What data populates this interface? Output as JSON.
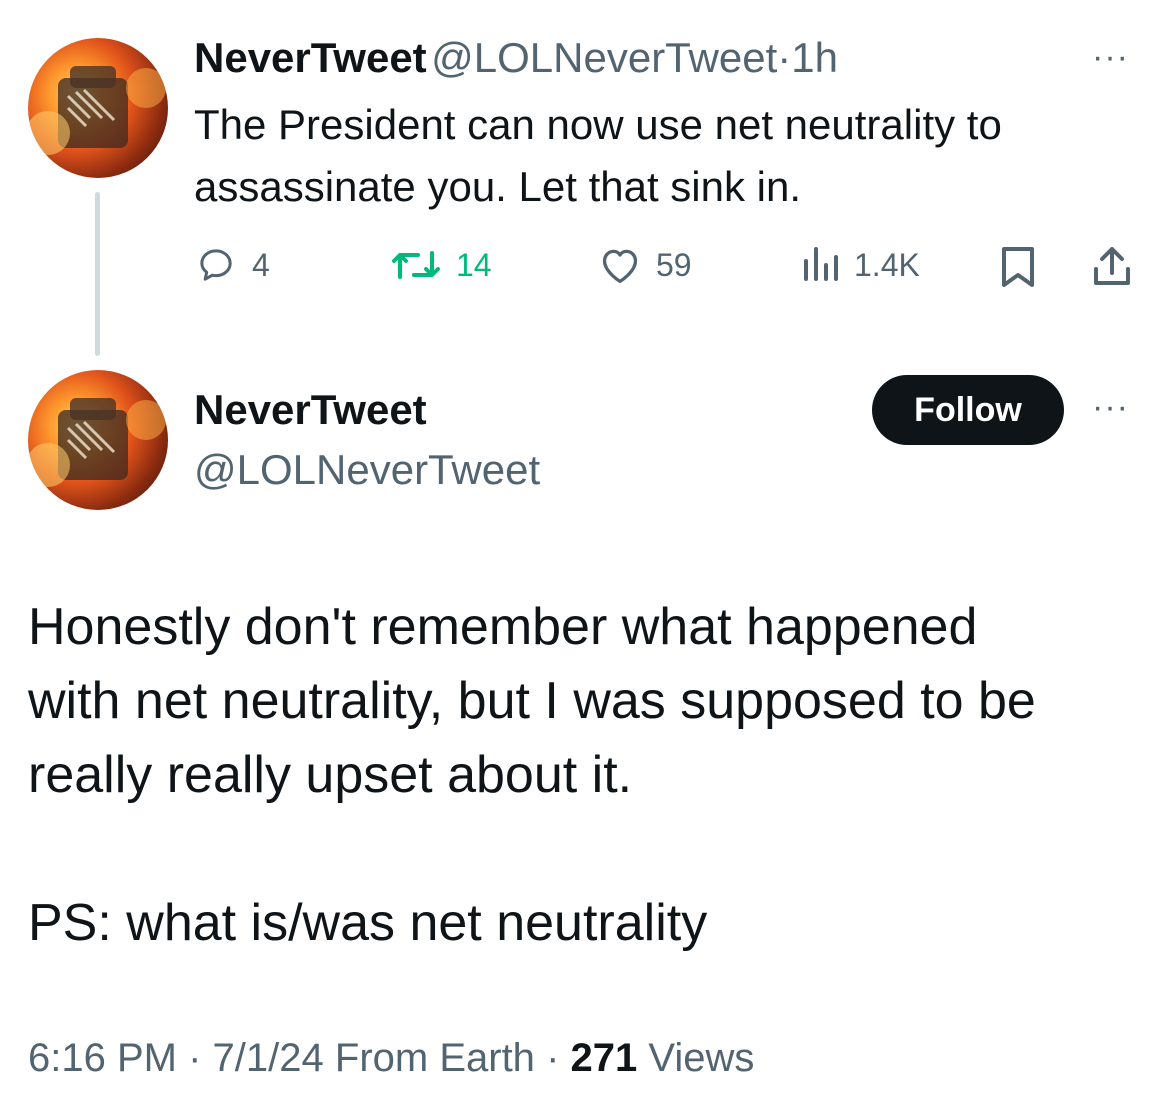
{
  "parent_tweet": {
    "display_name": "NeverTweet",
    "handle": "@LOLNeverTweet",
    "separator": "·",
    "time": "1h",
    "more": "···",
    "text_line1": "The President can now use net neutrality to",
    "text_line2": "assassinate you. Let that sink in.",
    "replies": "4",
    "reposts": "14",
    "likes": "59",
    "views": "1.4K"
  },
  "main_tweet": {
    "display_name": "NeverTweet",
    "handle": "@LOLNeverTweet",
    "follow_label": "Follow",
    "more": "···",
    "text_line1": "Honestly don't remember what happened",
    "text_line2": "with net neutrality, but I was supposed to be",
    "text_line3": "really really upset about it.",
    "text_line4": "PS: what is/was net neutrality",
    "time": "6:16 PM",
    "dot1": "·",
    "date": "7/1/24",
    "source": "From Earth",
    "dot2": "·",
    "view_count": "271",
    "views_label": "Views"
  },
  "colors": {
    "text": "#0f1419",
    "secondary": "#536471",
    "repost_green": "#00ba7c",
    "follow_bg": "#0f1419",
    "thread_line": "#cfd9de"
  },
  "icons": [
    "reply-icon",
    "repost-icon",
    "like-icon",
    "views-icon",
    "bookmark-icon",
    "share-icon",
    "more-icon"
  ]
}
